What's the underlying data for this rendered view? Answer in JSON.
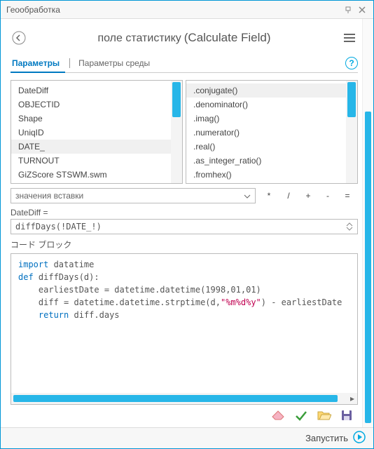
{
  "titlebar": {
    "title": "Геообработка"
  },
  "tool": {
    "alias": "поле статистику",
    "real": "(Calculate Field)"
  },
  "tabs": {
    "params": "Параметры",
    "env": "Параметры среды"
  },
  "fields": {
    "items": [
      "DateDiff",
      "OBJECTID",
      "Shape",
      "UniqID",
      "DATE_",
      "TURNOUT",
      "GiZScore STSWM.swm"
    ],
    "selected_index": 4
  },
  "methods": {
    "items": [
      ".conjugate()",
      ".denominator()",
      ".imag()",
      ".numerator()",
      ".real()",
      ".as_integer_ratio()",
      ".fromhex()"
    ],
    "selected_index": 0
  },
  "insert": {
    "label": "значения вставки"
  },
  "operators": {
    "mul": "*",
    "div": "/",
    "plus": "+",
    "minus": "-",
    "eq": "="
  },
  "expr": {
    "label": "DateDiff =",
    "value": "diffDays(!DATE_!)"
  },
  "codeblock": {
    "label": "コード ブロック",
    "lines": {
      "l1a": "import",
      "l1b": " datatime",
      "l2a": "def",
      "l2b": " diffDays(d):",
      "l3": "    earliestDate = datetime.datetime(1998,01,01)",
      "l4a": "    diff = datetime.datetime.strptime(d,",
      "l4s": "\"%m%d%y\"",
      "l4b": ") - earliestDate",
      "l5a": "    ",
      "l5b": "return",
      "l5c": " diff.days"
    }
  },
  "footer": {
    "run": "Запустить"
  }
}
